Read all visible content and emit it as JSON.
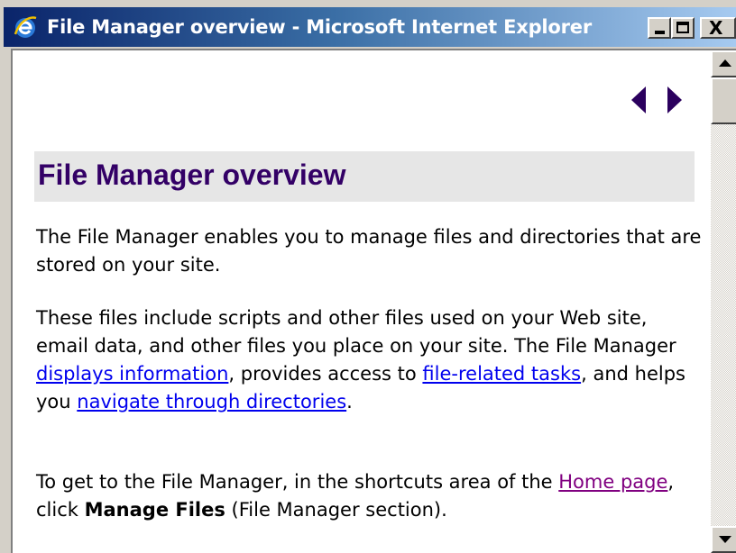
{
  "window": {
    "title": "File Manager overview - Microsoft Internet Explorer",
    "minimize_label": "_",
    "maximize_label": "□",
    "close_label": "X"
  },
  "page": {
    "heading": "File Manager overview",
    "nav": {
      "prev_icon": "left-triangle-arrow",
      "next_icon": "right-triangle-arrow",
      "color": "#2b005e"
    },
    "paragraph1": "The File Manager enables you to manage files and directories that are stored on your site.",
    "paragraph2": {
      "text_a": "These files include scripts and other files used on your Web site, email data, and other files you place on your site. The File Manager ",
      "link1": "displays information",
      "text_b": ", provides access to ",
      "link2": "file-related tasks",
      "text_c": ", and helps you ",
      "link3": "navigate through directories",
      "text_d": "."
    },
    "paragraph3": {
      "text_a": "To get to the File Manager, in the shortcuts area of the ",
      "link_home": "Home page",
      "text_b": ", click ",
      "bold": "Manage Files",
      "text_c": " (File Manager section)."
    }
  },
  "colors": {
    "heading": "#330066",
    "heading_bg": "#e6e6e6",
    "link": "#0000ee",
    "visited_link": "#800080",
    "titlebar_start": "#0a246a",
    "titlebar_end": "#a6caf0"
  }
}
